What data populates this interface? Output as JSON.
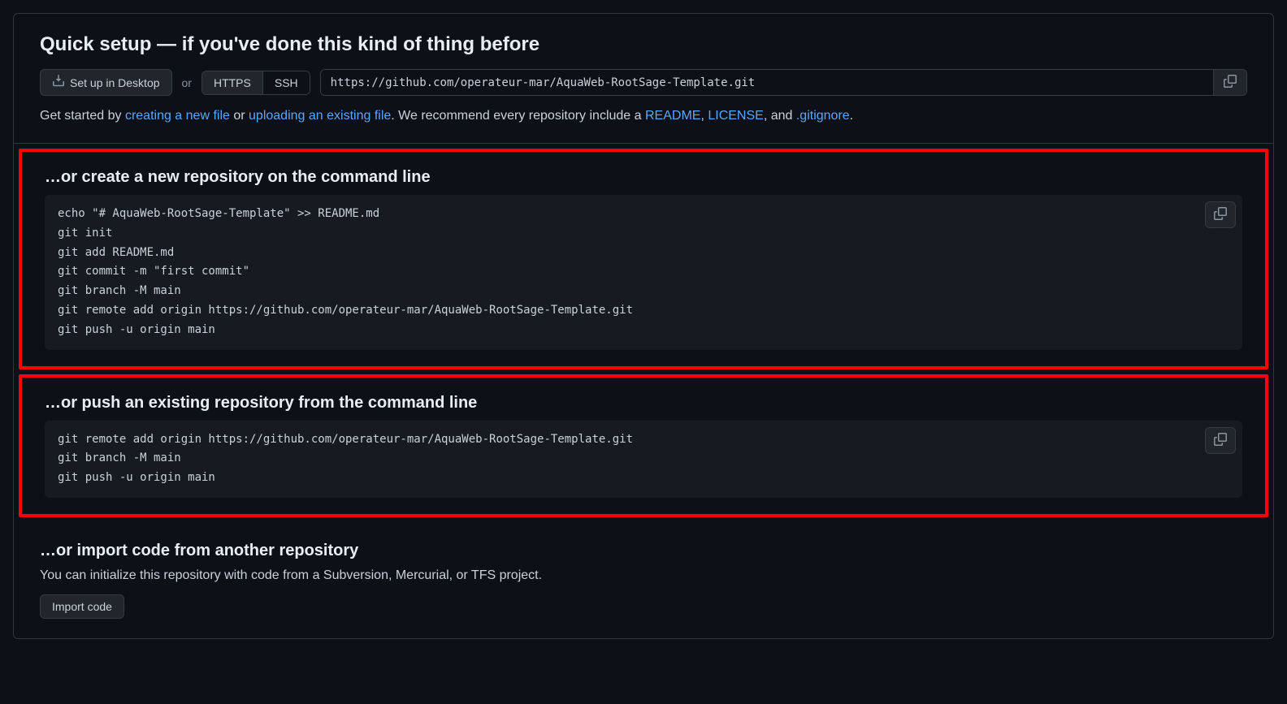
{
  "header": {
    "title": "Quick setup — if you've done this kind of thing before",
    "desktop_btn": "Set up in Desktop",
    "or": "or",
    "https": "HTTPS",
    "ssh": "SSH",
    "url": "https://github.com/operateur-mar/AquaWeb-RootSage-Template.git",
    "help_pre": "Get started by ",
    "link_create": "creating a new file",
    "help_or": " or ",
    "link_upload": "uploading an existing file",
    "help_mid": ". We recommend every repository include a ",
    "link_readme": "README",
    "comma1": ", ",
    "link_license": "LICENSE",
    "comma2": ", and ",
    "link_gitignore": ".gitignore",
    "help_end": "."
  },
  "create": {
    "title": "…or create a new repository on the command line",
    "code": "echo \"# AquaWeb-RootSage-Template\" >> README.md\ngit init\ngit add README.md\ngit commit -m \"first commit\"\ngit branch -M main\ngit remote add origin https://github.com/operateur-mar/AquaWeb-RootSage-Template.git\ngit push -u origin main"
  },
  "push": {
    "title": "…or push an existing repository from the command line",
    "code": "git remote add origin https://github.com/operateur-mar/AquaWeb-RootSage-Template.git\ngit branch -M main\ngit push -u origin main"
  },
  "import": {
    "title": "…or import code from another repository",
    "desc": "You can initialize this repository with code from a Subversion, Mercurial, or TFS project.",
    "btn": "Import code"
  }
}
